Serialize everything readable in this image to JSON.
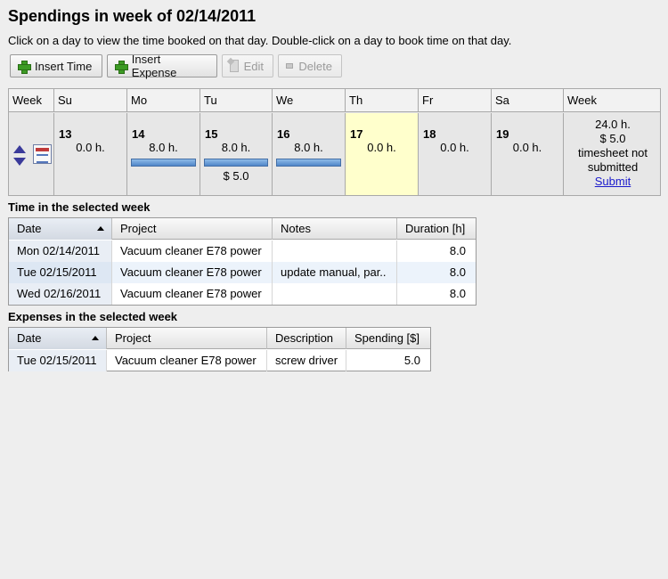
{
  "page": {
    "title": "Spendings in week of 02/14/2011",
    "subtitle": "Click on a day to view the time booked on that day. Double-click on a day to book time on that day."
  },
  "toolbar": {
    "insert_time": "Insert Time",
    "insert_expense": "Insert Expense",
    "edit": "Edit",
    "delete": "Delete"
  },
  "calendar": {
    "headers": [
      "Week",
      "Su",
      "Mo",
      "Tu",
      "We",
      "Th",
      "Fr",
      "Sa",
      "Week"
    ],
    "days": [
      {
        "num": "13",
        "hours": "0.0 h.",
        "spend": ""
      },
      {
        "num": "14",
        "hours": "8.0 h.",
        "spend": ""
      },
      {
        "num": "15",
        "hours": "8.0 h.",
        "spend": "$ 5.0"
      },
      {
        "num": "16",
        "hours": "8.0 h.",
        "spend": ""
      },
      {
        "num": "17",
        "hours": "0.0 h.",
        "spend": ""
      },
      {
        "num": "18",
        "hours": "0.0 h.",
        "spend": ""
      },
      {
        "num": "19",
        "hours": "0.0 h.",
        "spend": ""
      }
    ],
    "summary": {
      "hours": "24.0 h.",
      "spend": "$ 5.0",
      "status_line1": "timesheet not",
      "status_line2": "submitted",
      "submit": "Submit"
    },
    "today_color": "#ffffcc",
    "bar_color": "#5b8fd0"
  },
  "time_section": {
    "label": "Time in the selected week",
    "columns": [
      "Date",
      "Project",
      "Notes",
      "Duration [h]"
    ],
    "rows": [
      {
        "date": "Mon 02/14/2011",
        "project": "Vacuum cleaner E78 power",
        "notes": "",
        "duration": "8.0"
      },
      {
        "date": "Tue 02/15/2011",
        "project": "Vacuum cleaner E78 power",
        "notes": "update manual, par..",
        "duration": "8.0"
      },
      {
        "date": "Wed 02/16/2011",
        "project": "Vacuum cleaner E78 power",
        "notes": "",
        "duration": "8.0"
      }
    ]
  },
  "expense_section": {
    "label": "Expenses in the selected week",
    "columns": [
      "Date",
      "Project",
      "Description",
      "Spending [$]"
    ],
    "rows": [
      {
        "date": "Tue 02/15/2011",
        "project": "Vacuum cleaner E78 power",
        "description": "screw driver",
        "spending": "5.0"
      }
    ]
  }
}
